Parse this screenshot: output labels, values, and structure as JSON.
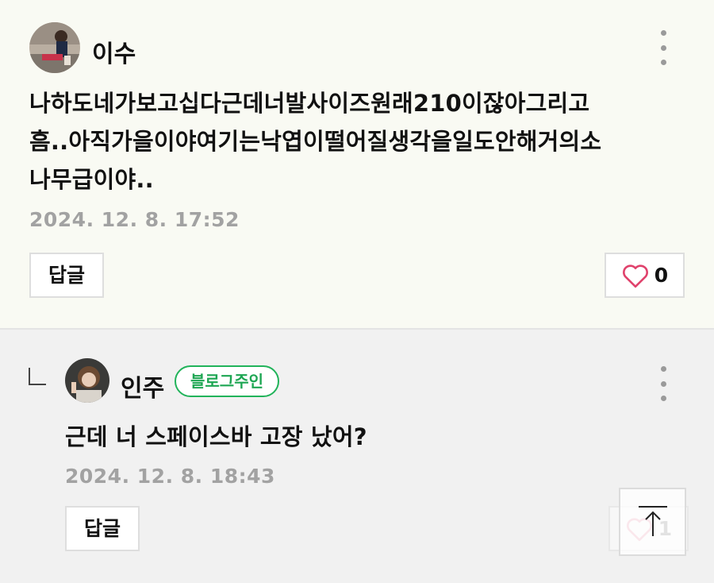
{
  "comments": [
    {
      "author": "이수",
      "text_lines": [
        "나하도네가보고십다근데너발사이즈원래210이잖아그리고",
        "흠..아직가을이야여기는낙엽이떨어질생각을일도안해거의소",
        "나무급이야.."
      ],
      "date": "2024. 12. 8. 17:52",
      "reply_label": "답글",
      "like_count": "0"
    },
    {
      "author": "인주",
      "badge": "블로그주인",
      "text": "근데 너 스페이스바 고장 났어?",
      "date": "2024. 12. 8. 18:43",
      "reply_label": "답글",
      "like_count": "1"
    }
  ],
  "colors": {
    "heart": "#e0426c",
    "badge_green": "#21b35a",
    "date_gray": "#a2a2a2"
  },
  "icons": [
    "more-vertical-icon",
    "heart-icon",
    "reply-arrow-icon",
    "arrow-up-to-top-icon"
  ]
}
